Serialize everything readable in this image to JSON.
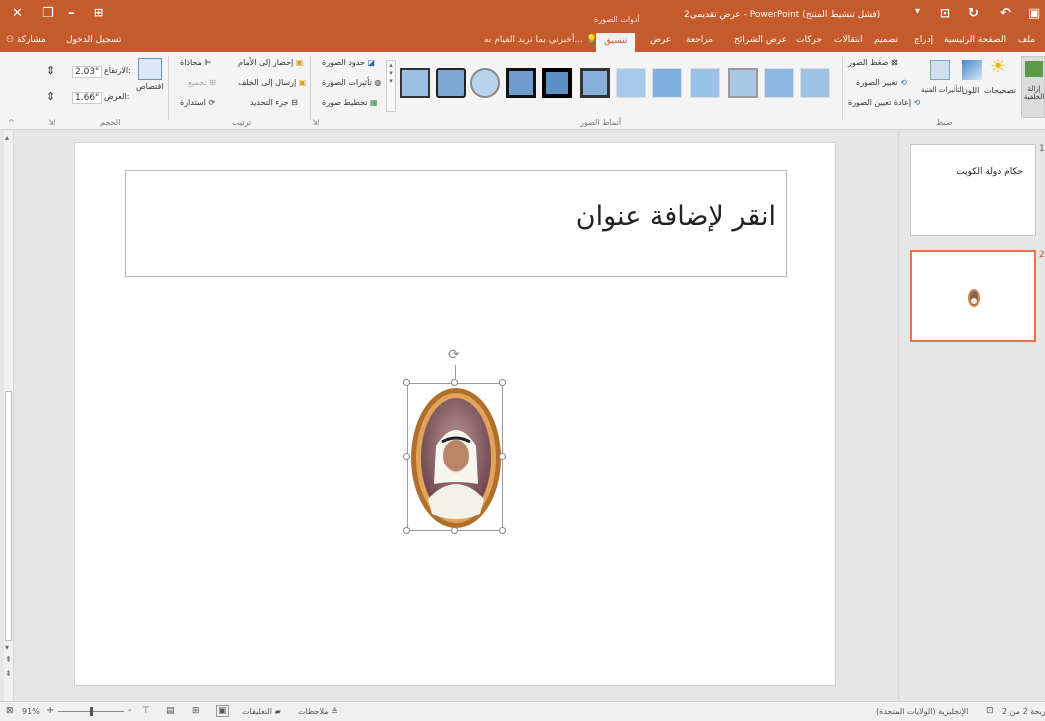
{
  "titlebar": {
    "window_title": "عرض تقديمي2 - PowerPoint (فشل تنشيط المنتج)",
    "context_tab": "أدوات الصورة",
    "share_label": "مشاركة",
    "signin_label": "تسجيل الدخول",
    "close_icon": "✕",
    "restore_icon": "❐",
    "minimize_icon": "–"
  },
  "tabs": {
    "file": "ملف",
    "home": "الصفحة الرئيسية",
    "insert": "إدراج",
    "design": "تصميم",
    "transitions": "انتقالات",
    "animations": "حركات",
    "slideshow": "عرض الشرائح",
    "review": "مراجعة",
    "view": "عرض",
    "format": "تنسيق",
    "tellme": "أخبرني بما تريد القيام به..."
  },
  "ribbon": {
    "adjust": {
      "remove_bg": "إزالة الخلفية",
      "corrections": "تصحيحات",
      "color": "اللون",
      "artistic": "التأثيرات الفنية",
      "compress": "ضغط الصور",
      "change": "تغيير الصورة",
      "reset": "إعادة تعيين الصورة",
      "group_label": "ضبط"
    },
    "styles": {
      "group_label": "أنماط الصور",
      "border": "حدود الصورة",
      "effects": "تأثيرات الصورة",
      "layout": "تخطيط صورة"
    },
    "arrange": {
      "bring_forward": "إحضار إلى الأمام",
      "send_backward": "إرسال إلى الخلف",
      "selection_pane": "جزء التحديد",
      "align": "محاذاة",
      "group": "تجميع",
      "rotate": "استدارة",
      "group_label": "ترتيب"
    },
    "size": {
      "crop": "اقتصاص",
      "height_label": "الارتفاع:",
      "height_value": "2.03\"",
      "width_label": "العرض:",
      "width_value": "1.66\"",
      "group_label": "الحجم"
    }
  },
  "slide": {
    "title_placeholder": "انقر لإضافة عنوان"
  },
  "thumbnails": [
    {
      "number": "1",
      "title": "حكام دولة الكويت"
    },
    {
      "number": "2",
      "title": ""
    }
  ],
  "status": {
    "slide_info": "شريحة 2 من 2",
    "language": "الإنجليزية (الولايات المتحدة)",
    "notes": "ملاحظات",
    "comments": "التعليقات",
    "zoom": "91%",
    "plus": "+",
    "minus": "-"
  },
  "colors": {
    "accent": "#c55a2b",
    "ribbon_bg": "#f4f4f4",
    "workspace": "#e6e6e6",
    "selected_thumb_border": "#e8734a"
  }
}
